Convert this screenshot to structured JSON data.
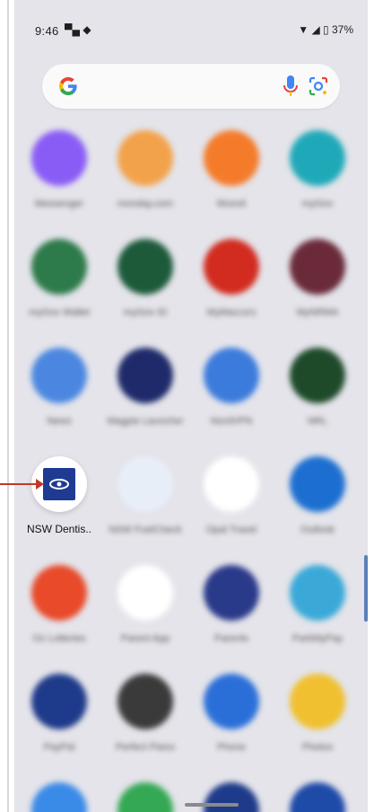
{
  "status_bar": {
    "time": "9:46",
    "battery": "37%",
    "left_icons": [
      "android-debug-icon",
      "navigation-icon"
    ],
    "right_icons": [
      "wifi-icon",
      "signal-icon",
      "battery-icon"
    ]
  },
  "search_bar": {
    "logo": "G",
    "mic_icon": "microphone-icon",
    "lens_icon": "google-lens-icon"
  },
  "apps": [
    {
      "id": "messenger",
      "label": "Messenger",
      "color": "#8a5cf6",
      "blurred": true
    },
    {
      "id": "monday",
      "label": "monday.com",
      "color": "#f2a24a",
      "blurred": true
    },
    {
      "id": "moovit",
      "label": "Moovit",
      "color": "#f47b2a",
      "blurred": true
    },
    {
      "id": "mydocs",
      "label": "myGov",
      "color": "#1fa9b8",
      "blurred": true
    },
    {
      "id": "app5",
      "label": "myGov Wallet",
      "color": "#2d7a4a",
      "blurred": true
    },
    {
      "id": "app6",
      "label": "myGov ID",
      "color": "#1c5a3a",
      "blurred": true
    },
    {
      "id": "mcdonalds",
      "label": "MyMacca's",
      "color": "#d22b1f",
      "blurred": true
    },
    {
      "id": "app8",
      "label": "MyNRMA",
      "color": "#6a2a3a",
      "blurred": true
    },
    {
      "id": "news",
      "label": "News",
      "color": "#4b87e0",
      "blurred": true
    },
    {
      "id": "app10",
      "label": "Magpie Launcher",
      "color": "#1e2a6a",
      "blurred": true
    },
    {
      "id": "nordvpn",
      "label": "NordVPN",
      "color": "#3b7bdc",
      "blurred": true
    },
    {
      "id": "app12",
      "label": "NRL",
      "color": "#1e4a2a",
      "blurred": true
    },
    {
      "id": "nsw-dentist",
      "label": "NSW Dentis..",
      "color": "#1f3a93",
      "blurred": false
    },
    {
      "id": "app14",
      "label": "NSW FuelCheck",
      "color": "#e8eef8",
      "blurred": true
    },
    {
      "id": "opal",
      "label": "Opal Travel",
      "color": "#ffffff",
      "blurred": true
    },
    {
      "id": "outlook",
      "label": "Outlook",
      "color": "#1c6fd1",
      "blurred": true
    },
    {
      "id": "lotteries",
      "label": "Oz Lotteries",
      "color": "#e84a2a",
      "blurred": true
    },
    {
      "id": "app18",
      "label": "Parent App",
      "color": "#ffffff",
      "blurred": true
    },
    {
      "id": "app19",
      "label": "Parents",
      "color": "#2a3a8a",
      "blurred": true
    },
    {
      "id": "parkmobile",
      "label": "ParkMyPay",
      "color": "#3aa9d8",
      "blurred": true
    },
    {
      "id": "paypal",
      "label": "PayPal",
      "color": "#1e3a8a",
      "blurred": true
    },
    {
      "id": "app22",
      "label": "Perfect Piano",
      "color": "#3a3a3a",
      "blurred": true
    },
    {
      "id": "phone",
      "label": "Phone",
      "color": "#2a6fd8",
      "blurred": true
    },
    {
      "id": "photos",
      "label": "Photos",
      "color": "#f0c030",
      "blurred": true
    },
    {
      "id": "app25",
      "label": "",
      "color": "#3a8ae8",
      "blurred": true
    },
    {
      "id": "playstore",
      "label": "",
      "color": "#34a853",
      "blurred": true
    },
    {
      "id": "playstation",
      "label": "",
      "color": "#1e3a8a",
      "blurred": true
    },
    {
      "id": "app28",
      "label": "",
      "color": "#1e4aa8",
      "blurred": true
    }
  ]
}
